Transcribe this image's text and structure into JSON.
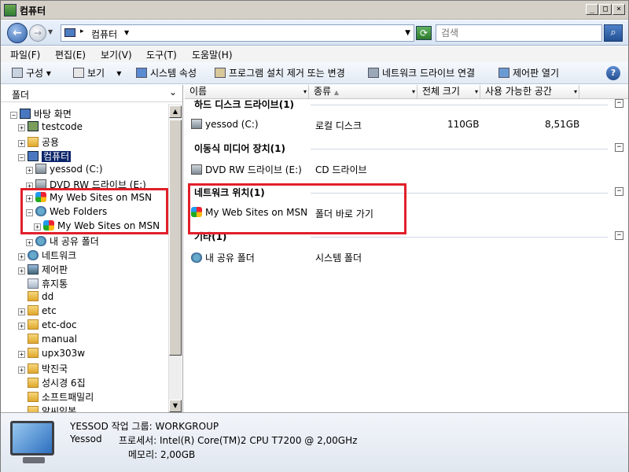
{
  "window": {
    "title": "컴퓨터",
    "controls": [
      "_",
      "□",
      "×"
    ]
  },
  "address": {
    "crumb": "컴퓨터",
    "search_placeholder": "검색"
  },
  "menu": [
    "파일(F)",
    "편집(E)",
    "보기(V)",
    "도구(T)",
    "도움말(H)"
  ],
  "commands": {
    "organize": "구성",
    "view": "보기",
    "properties": "시스템 속성",
    "uninstall": "프로그램 설치 제거 또는 변경",
    "map_drive": "네트워크 드라이브 연결",
    "control_panel": "제어판 열기"
  },
  "folderpane": {
    "header": "폴더",
    "items": [
      {
        "label": "바탕 화면",
        "indent": 0,
        "exp": "−"
      },
      {
        "label": "testcode",
        "indent": 1,
        "exp": "+"
      },
      {
        "label": "공용",
        "indent": 1,
        "exp": "+"
      },
      {
        "label": "컴퓨터",
        "indent": 1,
        "exp": "−"
      },
      {
        "label": "yessod (C:)",
        "indent": 2,
        "exp": "+"
      },
      {
        "label": "DVD RW 드라이브 (E:)",
        "indent": 2,
        "exp": "+"
      },
      {
        "label": "My Web Sites on MSN",
        "indent": 2,
        "exp": "+"
      },
      {
        "label": "Web Folders",
        "indent": 2,
        "exp": "−"
      },
      {
        "label": "My Web Sites on MSN",
        "indent": 3,
        "exp": "+"
      },
      {
        "label": "내 공유 폴더",
        "indent": 2,
        "exp": "+"
      },
      {
        "label": "네트워크",
        "indent": 1,
        "exp": "+"
      },
      {
        "label": "제어판",
        "indent": 1,
        "exp": "+"
      },
      {
        "label": "휴지통",
        "indent": 1,
        "exp": ""
      },
      {
        "label": "dd",
        "indent": 1,
        "exp": ""
      },
      {
        "label": "etc",
        "indent": 1,
        "exp": "+"
      },
      {
        "label": "etc-doc",
        "indent": 1,
        "exp": "+"
      },
      {
        "label": "manual",
        "indent": 1,
        "exp": ""
      },
      {
        "label": "upx303w",
        "indent": 1,
        "exp": "+"
      },
      {
        "label": "박진국",
        "indent": 1,
        "exp": "+"
      },
      {
        "label": "성시경 6집",
        "indent": 1,
        "exp": ""
      },
      {
        "label": "소프트패밀리",
        "indent": 1,
        "exp": ""
      },
      {
        "label": "알씨읽봉",
        "indent": 1,
        "exp": ""
      }
    ]
  },
  "columns": [
    "이름",
    "종류",
    "전체 크기",
    "사용 가능한 공간"
  ],
  "groups": [
    {
      "title": "하드 디스크 드라이브(1)",
      "items": [
        {
          "name": "yessod (C:)",
          "type": "로컬 디스크",
          "total": "110GB",
          "free": "8,51GB"
        }
      ]
    },
    {
      "title": "이동식 미디어 장치(1)",
      "items": [
        {
          "name": "DVD RW 드라이브 (E:)",
          "type": "CD 드라이브",
          "total": "",
          "free": ""
        }
      ]
    },
    {
      "title": "네트워크 위치(1)",
      "items": [
        {
          "name": "My Web Sites on MSN",
          "type": "폴더 바로 가기",
          "total": "",
          "free": ""
        }
      ]
    },
    {
      "title": "기타(1)",
      "items": [
        {
          "name": "내 공유 폴더",
          "type": "시스템 폴더",
          "total": "",
          "free": ""
        }
      ]
    }
  ],
  "details": {
    "line1": "YESSOD  작업 그룹: WORKGROUP",
    "line2_name": "Yessod",
    "line2_cpu": "프로세서: Intel(R) Core(TM)2 CPU         T7200  @ 2,00GHz",
    "line3": "메모리: 2,00GB"
  },
  "colors": {
    "highlight": "#e0202a",
    "selection": "#0a246a"
  }
}
